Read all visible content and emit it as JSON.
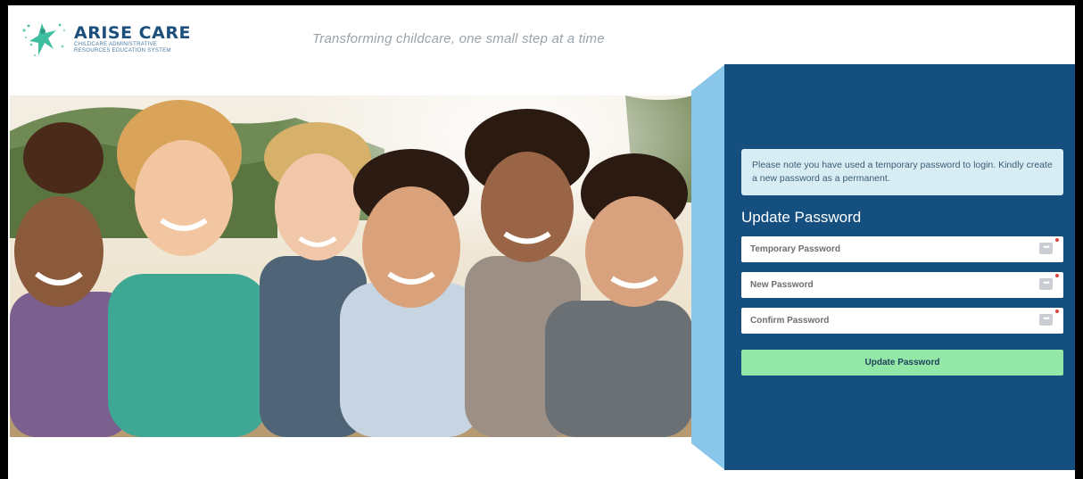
{
  "header": {
    "logo_title": "ARISE CARE",
    "logo_subtitle": "CHILDCARE ADMINISTRATIVE RESOURCES EDUCATION SYSTEM",
    "tagline": "Transforming childcare, one small step at a time"
  },
  "form": {
    "notice": "Please note you have used a temporary password to login. Kindly create a new password as a permanent.",
    "title": "Update Password",
    "fields": [
      {
        "placeholder": "Temporary Password",
        "required": true
      },
      {
        "placeholder": "New Password",
        "required": true
      },
      {
        "placeholder": "Confirm Password",
        "required": true
      }
    ],
    "submit_label": "Update Password",
    "dots_glyph": "•••"
  },
  "colors": {
    "panel": "#154f80",
    "panel_bevel": "#8ac6ea",
    "notice_bg": "#d8ecf3",
    "button": "#93e8a7",
    "logo_teal": "#3fbfa0",
    "logo_navy": "#1d4f7c",
    "required": "#e0413a"
  },
  "icons": {
    "logo": "star-figure-logo-icon",
    "field_action": "dots-icon",
    "required": "required-dot-icon"
  }
}
